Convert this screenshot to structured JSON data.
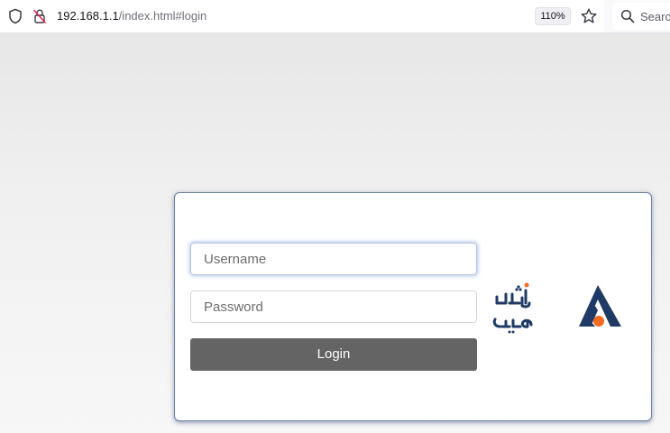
{
  "browser": {
    "url_host": "192.168.1.1",
    "url_path": "/index.html#login",
    "zoom": "110%",
    "search_placeholder": "Search",
    "icons": [
      "shield-icon",
      "insecure-lock-icon",
      "bookmark-star-icon",
      "search-icon"
    ]
  },
  "login": {
    "username_placeholder": "Username",
    "password_placeholder": "Password",
    "button_label": "Login"
  },
  "logo": {
    "wordmark": "شاتل موبایل",
    "colors": {
      "navy": "#1f3a64",
      "orange": "#f26b21"
    }
  }
}
